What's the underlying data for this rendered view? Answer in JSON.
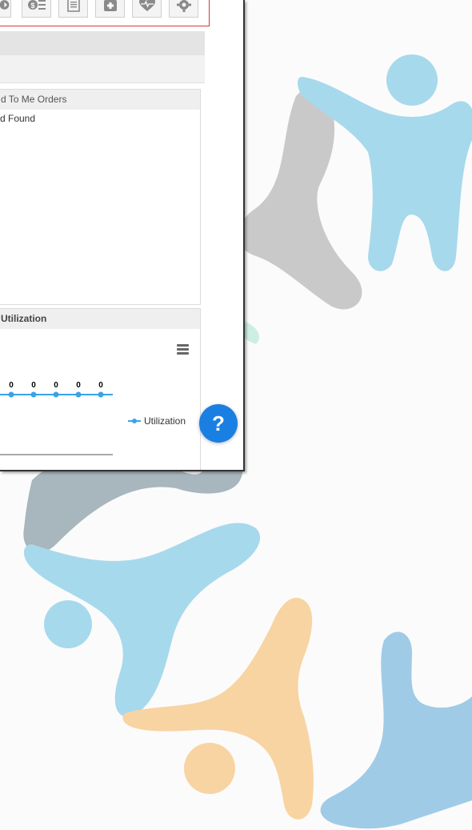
{
  "toolbar": {
    "buttons": [
      {
        "icon": "refresh-icon"
      },
      {
        "icon": "billing-icon"
      },
      {
        "icon": "document-icon"
      },
      {
        "icon": "medical-kit-icon"
      },
      {
        "icon": "heart-monitor-icon"
      },
      {
        "icon": "settings-icon"
      }
    ]
  },
  "orders_panel": {
    "title": "d To Me Orders",
    "empty_text": "d Found"
  },
  "utilization_panel": {
    "title": "Utilization",
    "legend_label": "Utilization",
    "series_color": "#3aa3e8"
  },
  "chart_data": {
    "type": "line",
    "title": "",
    "series": [
      {
        "name": "Utilization",
        "values": [
          0,
          0,
          0,
          0,
          0
        ]
      }
    ],
    "data_labels": [
      "0",
      "0",
      "0",
      "0",
      "0"
    ]
  },
  "help": {
    "label": "?"
  },
  "colors": {
    "accent": "#1a7fe3",
    "toolbar_border": "#d43a3a"
  }
}
